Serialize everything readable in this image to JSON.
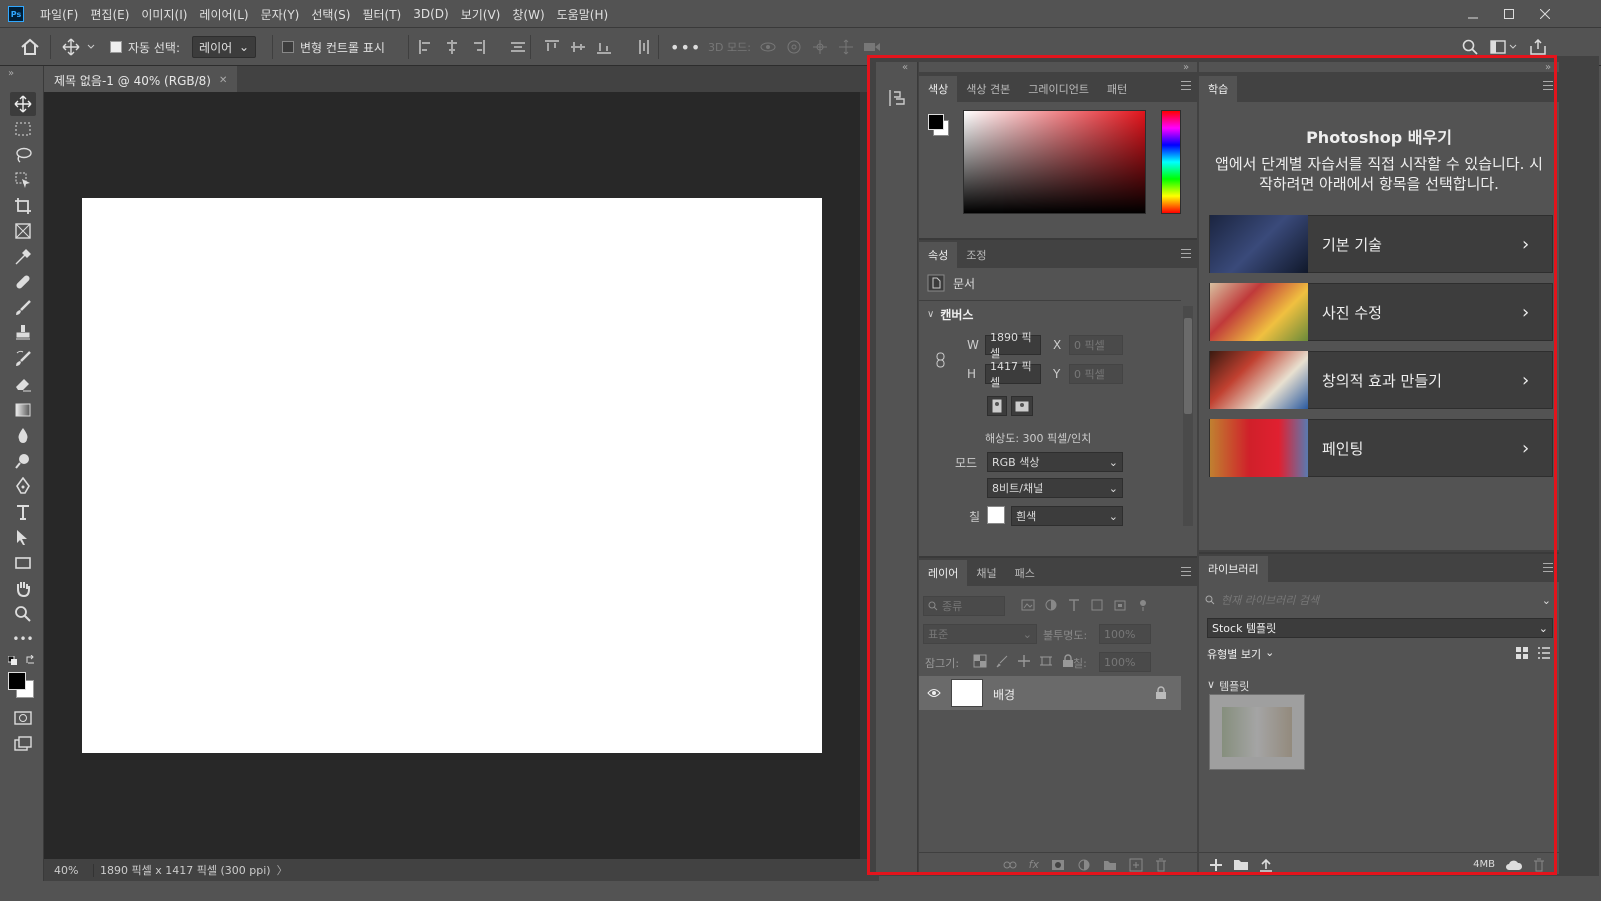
{
  "app": {
    "logo": "Ps"
  },
  "menu": [
    "파일(F)",
    "편집(E)",
    "이미지(I)",
    "레이어(L)",
    "문자(Y)",
    "선택(S)",
    "필터(T)",
    "3D(D)",
    "보기(V)",
    "창(W)",
    "도움말(H)"
  ],
  "options": {
    "auto_select_label": "자동 선택:",
    "auto_select_value": "레이어",
    "transform_label": "변형 컨트롤 표시",
    "mode_3d_label": "3D 모드:"
  },
  "document": {
    "tab_title": "제목 없음-1 @ 40% (RGB/8)",
    "zoom": "40%",
    "size_info": "1890 픽셀 x 1417 픽셀 (300 ppi)"
  },
  "color_panel": {
    "tabs": [
      "색상",
      "색상 견본",
      "그레이디언트",
      "패턴"
    ]
  },
  "properties_panel": {
    "tabs": [
      "속성",
      "조정"
    ],
    "doc_label": "문서",
    "section": "캔버스",
    "w_label": "W",
    "w_value": "1890 픽셀",
    "h_label": "H",
    "h_value": "1417 픽셀",
    "x_label": "X",
    "x_value": "0 픽셀",
    "y_label": "Y",
    "y_value": "0 픽셀",
    "resolution": "해상도: 300 픽셀/인치",
    "mode_label": "모드",
    "mode_value": "RGB 색상",
    "depth_value": "8비트/채널",
    "fill_label": "칠",
    "fill_value": "흰색"
  },
  "layers_panel": {
    "tabs": [
      "레이어",
      "채널",
      "패스"
    ],
    "filter_placeholder": "종류",
    "blend_mode": "표준",
    "opacity_label": "불투명도:",
    "opacity_value": "100%",
    "lock_label": "잠그기:",
    "fill_label": "칠:",
    "fill_value": "100%",
    "layer_name": "배경"
  },
  "learn_panel": {
    "tab": "학습",
    "title": "Photoshop 배우기",
    "desc": "앱에서 단계별 자습서를 직접 시작할 수 있습니다. 시작하려면 아래에서 항목을 선택합니다.",
    "items": [
      "기본 기술",
      "사진 수정",
      "창의적 효과 만들기",
      "페인팅"
    ]
  },
  "library_panel": {
    "tab": "라이브러리",
    "search_placeholder": "현재 라이브러리 검색",
    "library_select": "Stock 템플릿",
    "view_by": "유형별 보기",
    "section": "템플릿",
    "storage": "4MB"
  },
  "colors": {
    "highlight": "#e3141c",
    "bg": "#535353",
    "canvas_bg": "#282828"
  }
}
